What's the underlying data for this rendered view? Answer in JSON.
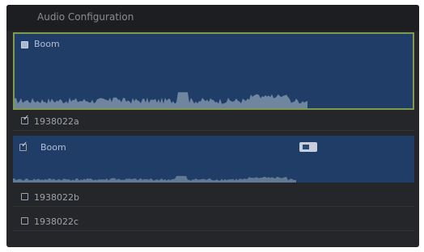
{
  "window": {
    "title": "Audio Configuration"
  },
  "tracks": [
    {
      "label": "Boom",
      "state": "checked",
      "selected": true
    },
    {
      "label": "1938022a",
      "state": "checked"
    },
    {
      "label": "Boom",
      "state": "checked",
      "has_badge": true
    },
    {
      "label": "1938022b",
      "state": "unchecked"
    },
    {
      "label": "1938022c",
      "state": "unchecked"
    }
  ],
  "colors": {
    "track_fill": "#1f3d66",
    "waveform": "#7f93a8",
    "selection_border": "#7f9a4a"
  },
  "icons": {
    "checkbox_checked": "check-square-icon",
    "checkbox_unchecked": "square-icon",
    "badge": "toggle-badge-icon"
  }
}
